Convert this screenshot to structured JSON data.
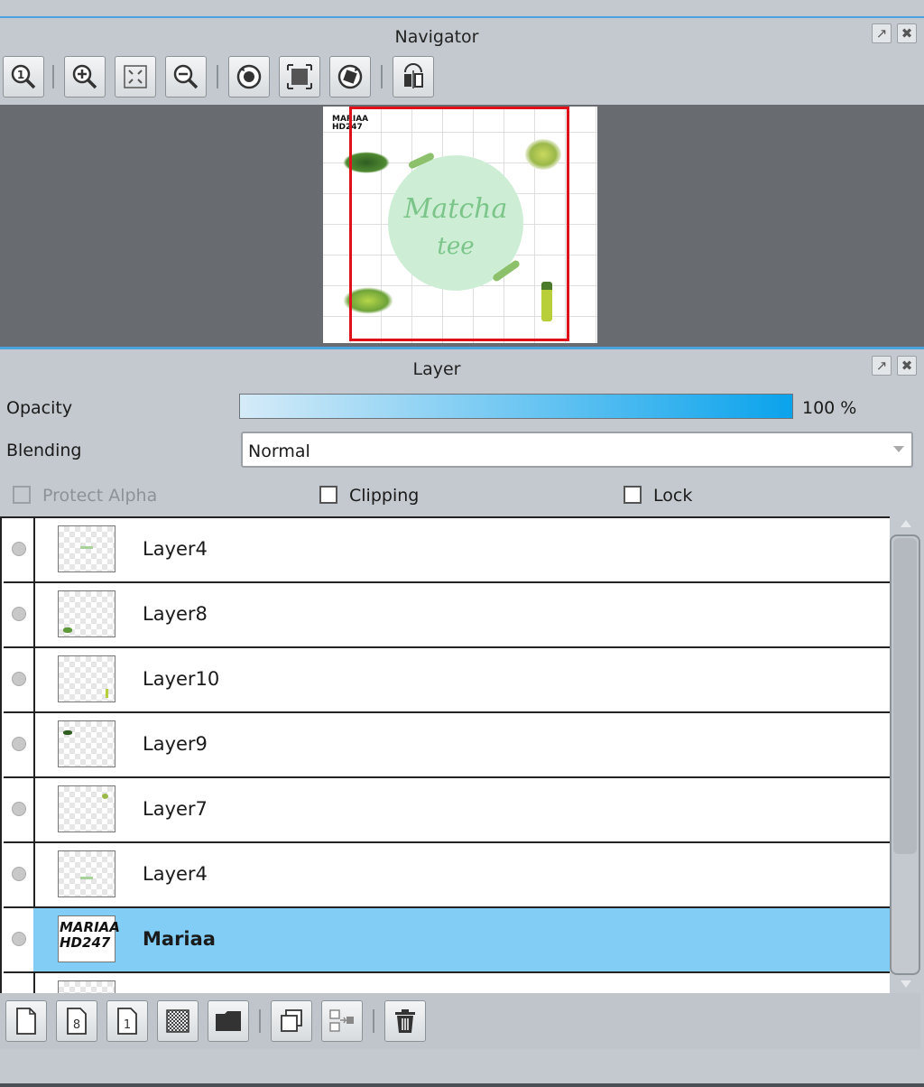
{
  "navigator": {
    "title": "Navigator",
    "preview_watermark": "MARIAA\nHD247",
    "preview_text_line1": "Matcha",
    "preview_text_line2": "tee"
  },
  "layer_panel": {
    "title": "Layer",
    "opacity_label": "Opacity",
    "opacity_value": "100 %",
    "opacity_level": 1.0,
    "blending_label": "Blending",
    "blending_value": "Normal",
    "protect_alpha_label": "Protect Alpha",
    "clipping_label": "Clipping",
    "lock_label": "Lock",
    "layers": [
      {
        "name": "Layer4",
        "selected": false
      },
      {
        "name": "Layer8",
        "selected": false
      },
      {
        "name": "Layer10",
        "selected": false
      },
      {
        "name": "Layer9",
        "selected": false
      },
      {
        "name": "Layer7",
        "selected": false
      },
      {
        "name": "Layer4",
        "selected": false
      },
      {
        "name": "Mariaa",
        "selected": true,
        "thumb_text": "MARIAA\nHD247"
      }
    ]
  },
  "colors": {
    "panel_bg": "#c3c9ce",
    "canvas_bg": "#686c70",
    "selection_accent": "#82cdf5",
    "viewport_frame": "#e0101a",
    "opacity_bar": "#0aa3ec"
  }
}
